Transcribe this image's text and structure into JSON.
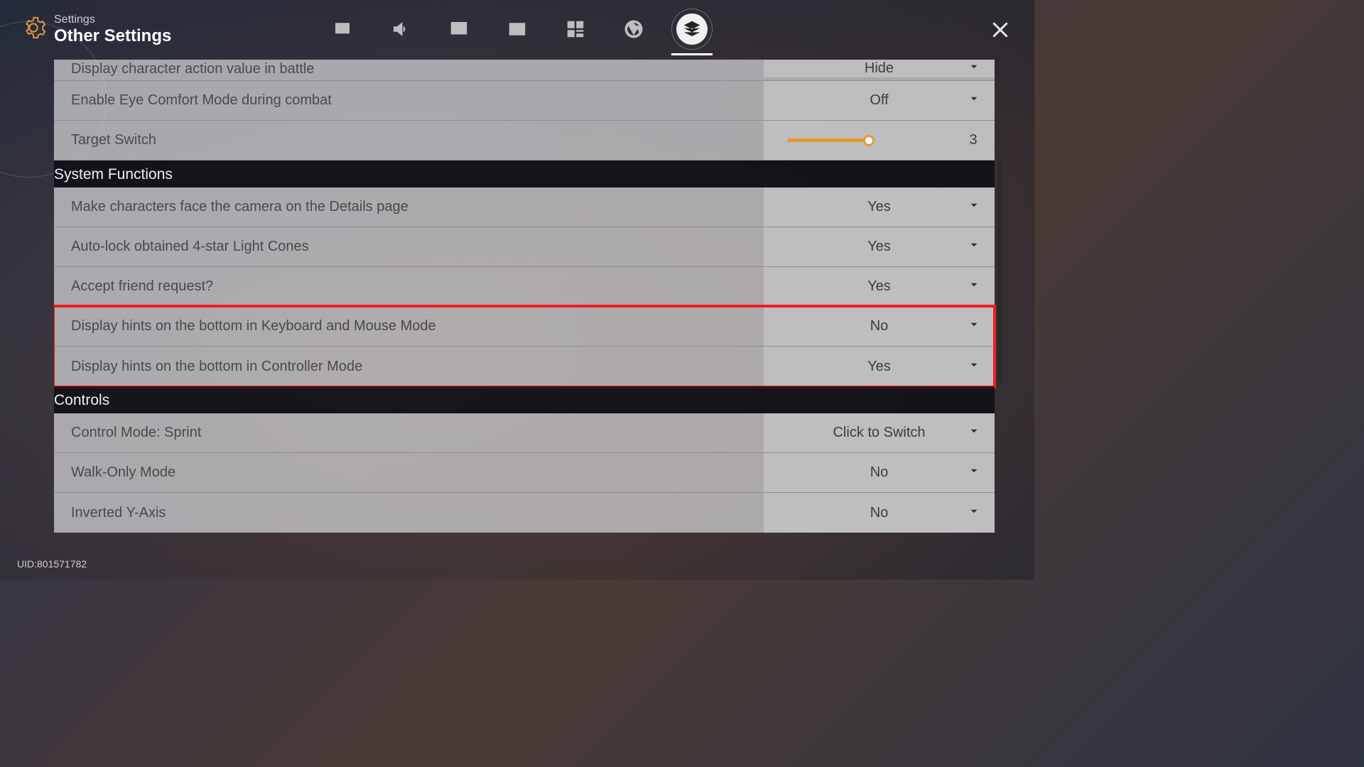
{
  "header": {
    "title_small": "Settings",
    "title_large": "Other Settings"
  },
  "tabs": [
    {
      "name": "display",
      "icon": "image-icon",
      "active": false
    },
    {
      "name": "audio",
      "icon": "speaker-icon",
      "active": false
    },
    {
      "name": "language",
      "icon": "language-icon",
      "active": false
    },
    {
      "name": "account",
      "icon": "id-card-icon",
      "active": false
    },
    {
      "name": "grid",
      "icon": "grid-icon",
      "active": false
    },
    {
      "name": "camera",
      "icon": "aperture-icon",
      "active": false
    },
    {
      "name": "other",
      "icon": "layers-icon",
      "active": true
    }
  ],
  "sections": [
    {
      "name": "combat_overflow",
      "title": null,
      "rows": [
        {
          "id": "action-value",
          "label": "Display character action value in battle",
          "type": "select",
          "value": "Hide",
          "clipped": true
        },
        {
          "id": "eye-comfort",
          "label": "Enable Eye Comfort Mode during combat",
          "type": "select",
          "value": "Off"
        },
        {
          "id": "target-switch",
          "label": "Target Switch",
          "type": "slider",
          "value": 3,
          "min": 1,
          "max": 5
        }
      ]
    },
    {
      "name": "system_functions",
      "title": "System Functions",
      "rows": [
        {
          "id": "face-camera",
          "label": "Make characters face the camera on the Details page",
          "type": "select",
          "value": "Yes"
        },
        {
          "id": "auto-lock-cones",
          "label": "Auto-lock obtained 4-star Light Cones",
          "type": "select",
          "value": "Yes"
        },
        {
          "id": "accept-friend",
          "label": "Accept friend request?",
          "type": "select",
          "value": "Yes"
        },
        {
          "id": "hints-kbm",
          "label": "Display hints on the bottom in Keyboard and Mouse Mode",
          "type": "select",
          "value": "No",
          "highlight": true
        },
        {
          "id": "hints-controller",
          "label": "Display hints on the bottom in Controller Mode",
          "type": "select",
          "value": "Yes",
          "highlight": true
        }
      ]
    },
    {
      "name": "controls",
      "title": "Controls",
      "rows": [
        {
          "id": "control-sprint",
          "label": "Control Mode: Sprint",
          "type": "select",
          "value": "Click to Switch"
        },
        {
          "id": "walk-only",
          "label": "Walk-Only Mode",
          "type": "select",
          "value": "No"
        },
        {
          "id": "inverted-y",
          "label": "Inverted Y-Axis",
          "type": "select",
          "value": "No"
        }
      ]
    }
  ],
  "footer": {
    "uid_label": "UID:",
    "uid_value": "801571782"
  }
}
